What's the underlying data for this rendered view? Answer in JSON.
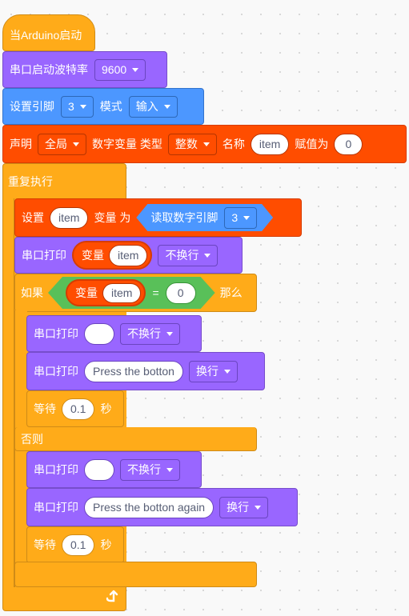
{
  "colors": {
    "control": "#ffab19",
    "serial": "#9966ff",
    "pin": "#4c97ff",
    "variable": "#ff4d00",
    "operator": "#59c059"
  },
  "hat_block": {
    "label": "当Arduino启动"
  },
  "serial_begin": {
    "label": "串口启动波特率",
    "baud": "9600"
  },
  "pin_mode": {
    "label": "设置引脚",
    "pin": "3",
    "mode_label": "模式",
    "mode": "输入"
  },
  "declare": {
    "label": "声明",
    "scope": "全局",
    "type_label": "数字变量 类型",
    "type": "整数",
    "name_label": "名称",
    "name": "item",
    "assign_label": "赋值为",
    "value": "0"
  },
  "loop": {
    "label": "重复执行",
    "loop_icon": "loop-arrow-icon"
  },
  "set_var": {
    "label": "设置",
    "var": "item",
    "mid_label": "变量 为",
    "reporter_label": "读取数字引脚",
    "pin": "3"
  },
  "print_var": {
    "label": "串口打印",
    "var_label": "变量",
    "var": "item",
    "newline": "不换行"
  },
  "if_block": {
    "if_label": "如果",
    "var_label": "变量",
    "var": "item",
    "op": "=",
    "value": "0",
    "then_label": "那么",
    "else_label": "否则"
  },
  "then_branch": {
    "print1": {
      "label": "串口打印",
      "text": "",
      "newline": "不换行"
    },
    "print2": {
      "label": "串口打印",
      "text": "Press the botton",
      "newline": "换行"
    },
    "wait": {
      "label": "等待",
      "value": "0.1",
      "unit": "秒"
    }
  },
  "else_branch": {
    "print1": {
      "label": "串口打印",
      "text": "",
      "newline": "不换行"
    },
    "print2": {
      "label": "串口打印",
      "text": "Press the botton again",
      "newline": "换行"
    },
    "wait": {
      "label": "等待",
      "value": "0.1",
      "unit": "秒"
    }
  }
}
